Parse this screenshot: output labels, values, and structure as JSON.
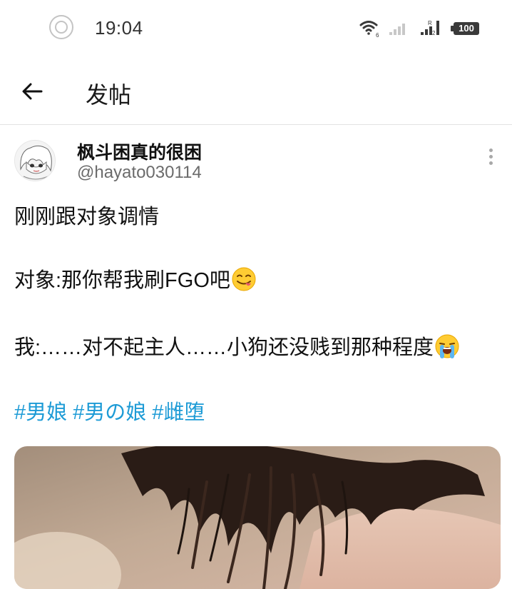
{
  "status_bar": {
    "time": "19:04",
    "battery": "100",
    "icons": [
      "do-not-disturb-icon",
      "wifi-icon",
      "signal-sim1-icon",
      "signal-sim2-icon",
      "battery-icon"
    ]
  },
  "app_bar": {
    "title": "发帖",
    "back_icon": "back-arrow-icon"
  },
  "post": {
    "author_name": "枫斗困真的很困",
    "handle": "@hayato030114",
    "lines": [
      "刚刚跟对象调情",
      "对象:那你帮我刷FGO吧",
      "我:……对不起主人……小狗还没贱到那种程度"
    ],
    "emojis": [
      "yum-face-emoji",
      "loudly-crying-face-emoji"
    ],
    "hashtags": [
      "#男娘",
      "#男の娘",
      "#雌堕"
    ],
    "menu_icon": "more-vertical-icon"
  },
  "colors": {
    "accent": "#1d9bd6",
    "text": "#111111",
    "secondary_text": "#6b6b6b",
    "divider": "#e2e2e2"
  }
}
